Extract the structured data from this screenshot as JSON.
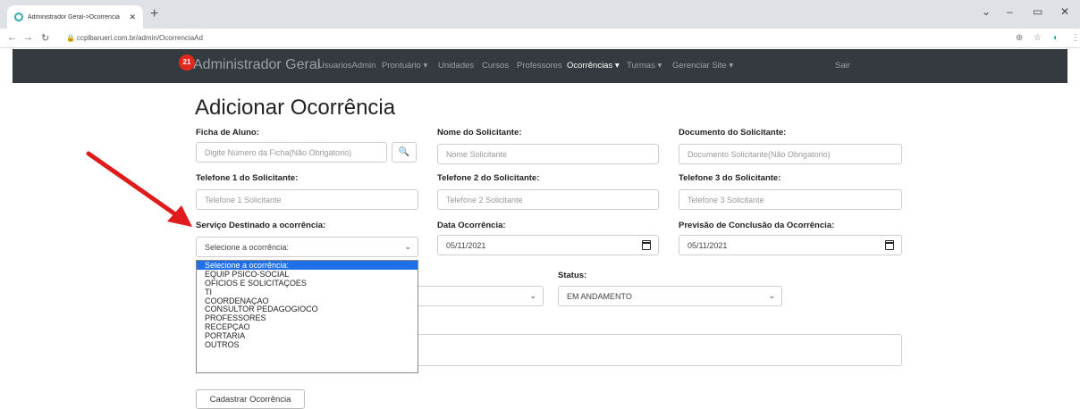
{
  "browser": {
    "tab_title": "Administrador Geral->Ocorrencia",
    "url": "ccplbarueri.com.br/admin/OcorrenciaAd",
    "icons": [
      "back-icon",
      "forward-icon",
      "reload-icon",
      "lock-icon",
      "zoom-icon",
      "star-icon",
      "extension-icon",
      "menu-icon"
    ]
  },
  "navbar": {
    "badge": "21",
    "brand": "Administrador Geral",
    "links": [
      "UsuariosAdmin",
      "Prontuário ▾",
      "Unidades",
      "Cursos",
      "Professores",
      "Ocorrências ▾",
      "Turmas ▾",
      "Gerenciar Site ▾",
      "Sair"
    ],
    "active": "Ocorrências ▾"
  },
  "form": {
    "title": "Adicionar Ocorrência",
    "ficha_label": "Ficha de Aluno:",
    "ficha_placeholder": "Digite Número da Ficha(Não Obrigatorio)",
    "nome_label": "Nome do Solicitante:",
    "nome_placeholder": "Nome Solicitante",
    "doc_label": "Documento do Solicitante:",
    "doc_placeholder": "Documento Solicitante(Não Obrigatorio)",
    "tel1_label": "Telefone 1 do Solicitante:",
    "tel1_placeholder": "Telefone 1 Solicitante",
    "tel2_label": "Telefone 2 do Solicitante:",
    "tel2_placeholder": "Telefone 2 Solicitante",
    "tel3_label": "Telefone 3 do Solicitante:",
    "tel3_placeholder": "Telefone 3 Solicitante",
    "servico_label": "Serviço Destinado a ocorrência:",
    "servico_value": "Selecione a ocorrência:",
    "data_label": "Data Ocorrência:",
    "data_value": "05/11/2021",
    "previsao_label": "Previsão de Conclusão da Ocorrência:",
    "previsao_value": "05/11/2021",
    "status_label": "Status:",
    "status_value": "EM ANDAMENTO",
    "submit_label": "Cadastrar Ocorrência"
  },
  "dropdown_options": [
    "Selecione a ocorrência:",
    "EQUIP PSICO-SOCIAL",
    "OFICIOS E SOLICITAÇOES",
    "TI",
    "COORDENAÇAO",
    "CONSULTOR PEDAGOGIOCO",
    "PROFESSORES",
    "RECEPÇAO",
    "PORTARIA",
    "OUTROS"
  ],
  "colors": {
    "navbar": "#343a40",
    "badge": "#e0281c",
    "selected_option": "#1e6fe8",
    "arrow": "#e01b1b"
  }
}
